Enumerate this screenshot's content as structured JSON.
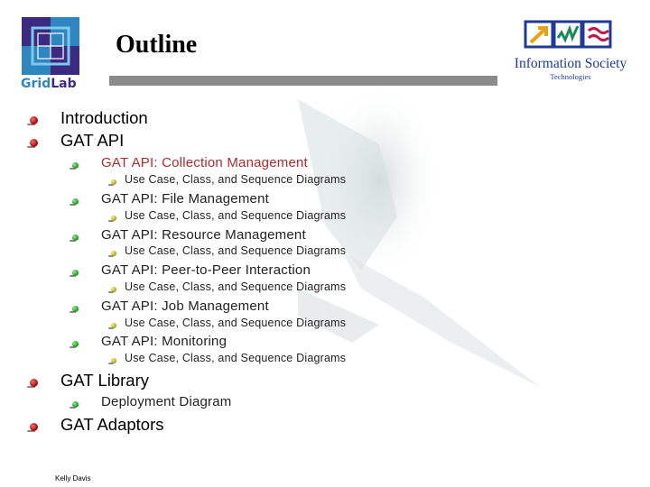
{
  "slide": {
    "title": "Outline",
    "logos": {
      "left": {
        "name": "GridLab",
        "text_grid": "Grid",
        "text_lab": "Lab"
      },
      "right": {
        "name": "Information Society Technologies",
        "line1": "Information Society",
        "line2": "Technologies"
      }
    },
    "outline": [
      {
        "level": 1,
        "text": "Introduction"
      },
      {
        "level": 1,
        "text": "GAT API"
      },
      {
        "level": 2,
        "text": "GAT API: Collection Management",
        "highlighted": true
      },
      {
        "level": 3,
        "text": "Use Case, Class, and Sequence Diagrams"
      },
      {
        "level": 2,
        "text": "GAT API: File Management"
      },
      {
        "level": 3,
        "text": "Use Case, Class, and Sequence Diagrams"
      },
      {
        "level": 2,
        "text": "GAT API: Resource Management"
      },
      {
        "level": 3,
        "text": "Use Case, Class, and Sequence Diagrams"
      },
      {
        "level": 2,
        "text": "GAT API: Peer-to-Peer Interaction"
      },
      {
        "level": 3,
        "text": "Use Case, Class, and Sequence Diagrams"
      },
      {
        "level": 2,
        "text": "GAT API: Job Management"
      },
      {
        "level": 3,
        "text": "Use Case, Class, and Sequence Diagrams"
      },
      {
        "level": 2,
        "text": "GAT API: Monitoring"
      },
      {
        "level": 3,
        "text": "Use Case, Class, and Sequence Diagrams"
      },
      {
        "level": 1,
        "text": "GAT Library"
      },
      {
        "level": 2,
        "text": "Deployment Diagram"
      },
      {
        "level": 1,
        "text": "GAT Adaptors"
      }
    ],
    "footer": "Kelly Davis",
    "colors": {
      "highlight": "#b02a2a",
      "title_bar": "#8a8a8a",
      "gridlab_dark": "#3a2a80",
      "gridlab_light": "#2e86c1",
      "ist_frame": "#1f3a93"
    }
  }
}
